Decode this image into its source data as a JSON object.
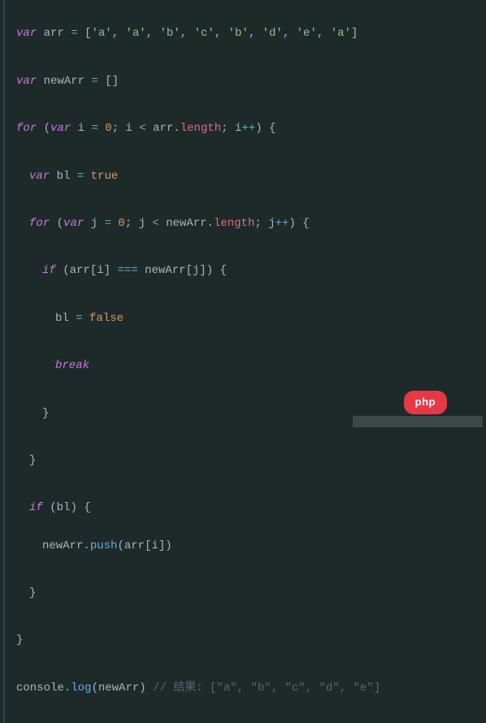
{
  "code": {
    "l1": {
      "kw": "var",
      "v": "arr",
      "eq": "=",
      "ob": "[",
      "cb": "]",
      "items": [
        "'a'",
        "'a'",
        "'b'",
        "'c'",
        "'b'",
        "'d'",
        "'e'",
        "'a'"
      ],
      "comma": ", "
    },
    "l2": {
      "kw": "var",
      "v": "newArr",
      "eq": "=",
      "ob": "[",
      "cb": "]"
    },
    "l3": {
      "for": "for",
      "op": "(",
      "kw": "var",
      "v": "i",
      "eq": "=",
      "zero": "0",
      "sc1": ";",
      "cmp": "i",
      "lt": "<",
      "arr": "arr",
      "dot": ".",
      "len": "length",
      "sc2": ";",
      "inc": "i",
      "pp": "++",
      "cp": ")",
      "ob": "{"
    },
    "l4": {
      "kw": "var",
      "v": "bl",
      "eq": "=",
      "val": "true"
    },
    "l5": {
      "for": "for",
      "op": "(",
      "kw": "var",
      "v": "j",
      "eq": "=",
      "zero": "0",
      "sc1": ";",
      "cmp": "j",
      "lt": "<",
      "arr": "newArr",
      "dot": ".",
      "len": "length",
      "sc2": ";",
      "inc": "j",
      "pp": "++",
      "cp": ")",
      "ob": "{"
    },
    "l6": {
      "if": "if",
      "op": "(",
      "arr1": "arr",
      "ob1": "[",
      "i": "i",
      "cb1": "]",
      "eqeq": "===",
      "arr2": "newArr",
      "ob2": "[",
      "j": "j",
      "cb2": "]",
      "cp": ")",
      "obr": "{"
    },
    "l7": {
      "v": "bl",
      "eq": "=",
      "val": "false"
    },
    "l8": {
      "kw": "break"
    },
    "l9": {
      "cb": "}"
    },
    "l10": {
      "cb": "}"
    },
    "l11": {
      "if": "if",
      "op": "(",
      "v": "bl",
      "cp": ")",
      "ob": "{"
    },
    "l12": {
      "arr": "newArr",
      "dot": ".",
      "meth": "push",
      "op": "(",
      "a2": "arr",
      "ob": "[",
      "i": "i",
      "cb": "]",
      "cp": ")"
    },
    "l13": {
      "cb": "}"
    },
    "l14": {
      "cb": "}"
    },
    "l15": {
      "obj": "console",
      "dot": ".",
      "meth": "log",
      "op": "(",
      "arg": "newArr",
      "cp": ")",
      "cmt": " // 结果: [\"a\", \"b\", \"c\", \"d\", \"e\"]"
    }
  },
  "logo": "php"
}
